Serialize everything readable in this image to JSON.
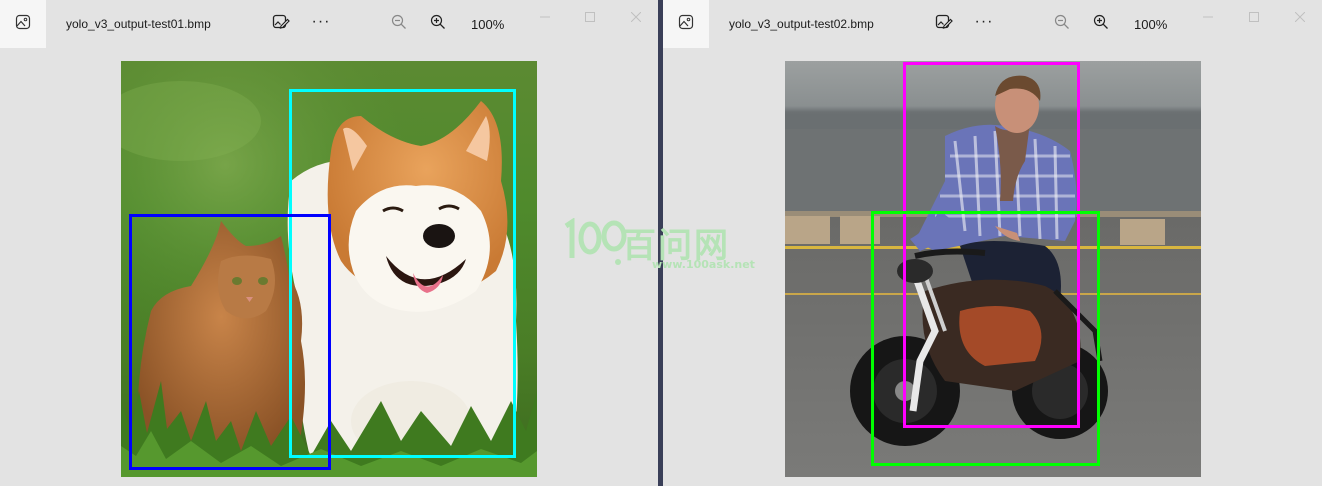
{
  "windows": [
    {
      "title": "yolo_v3_output-test01.bmp",
      "zoom": "100%",
      "more_label": "···",
      "box_colors": {
        "dog": "#00ffff",
        "cat": "#0000ff"
      }
    },
    {
      "title": "yolo_v3_output-test02.bmp",
      "zoom": "100%",
      "more_label": "···",
      "box_colors": {
        "person": "#ff00ff",
        "motorbike": "#00ff00"
      }
    }
  ],
  "watermark": {
    "brand": "百问网",
    "url": "www.100ask.net",
    "color": "#b5e3b6"
  },
  "icons": [
    "gallery-icon",
    "edit-image-icon",
    "more-icon",
    "zoom-out-icon",
    "zoom-in-icon",
    "minimize-icon",
    "maximize-icon",
    "close-icon"
  ]
}
